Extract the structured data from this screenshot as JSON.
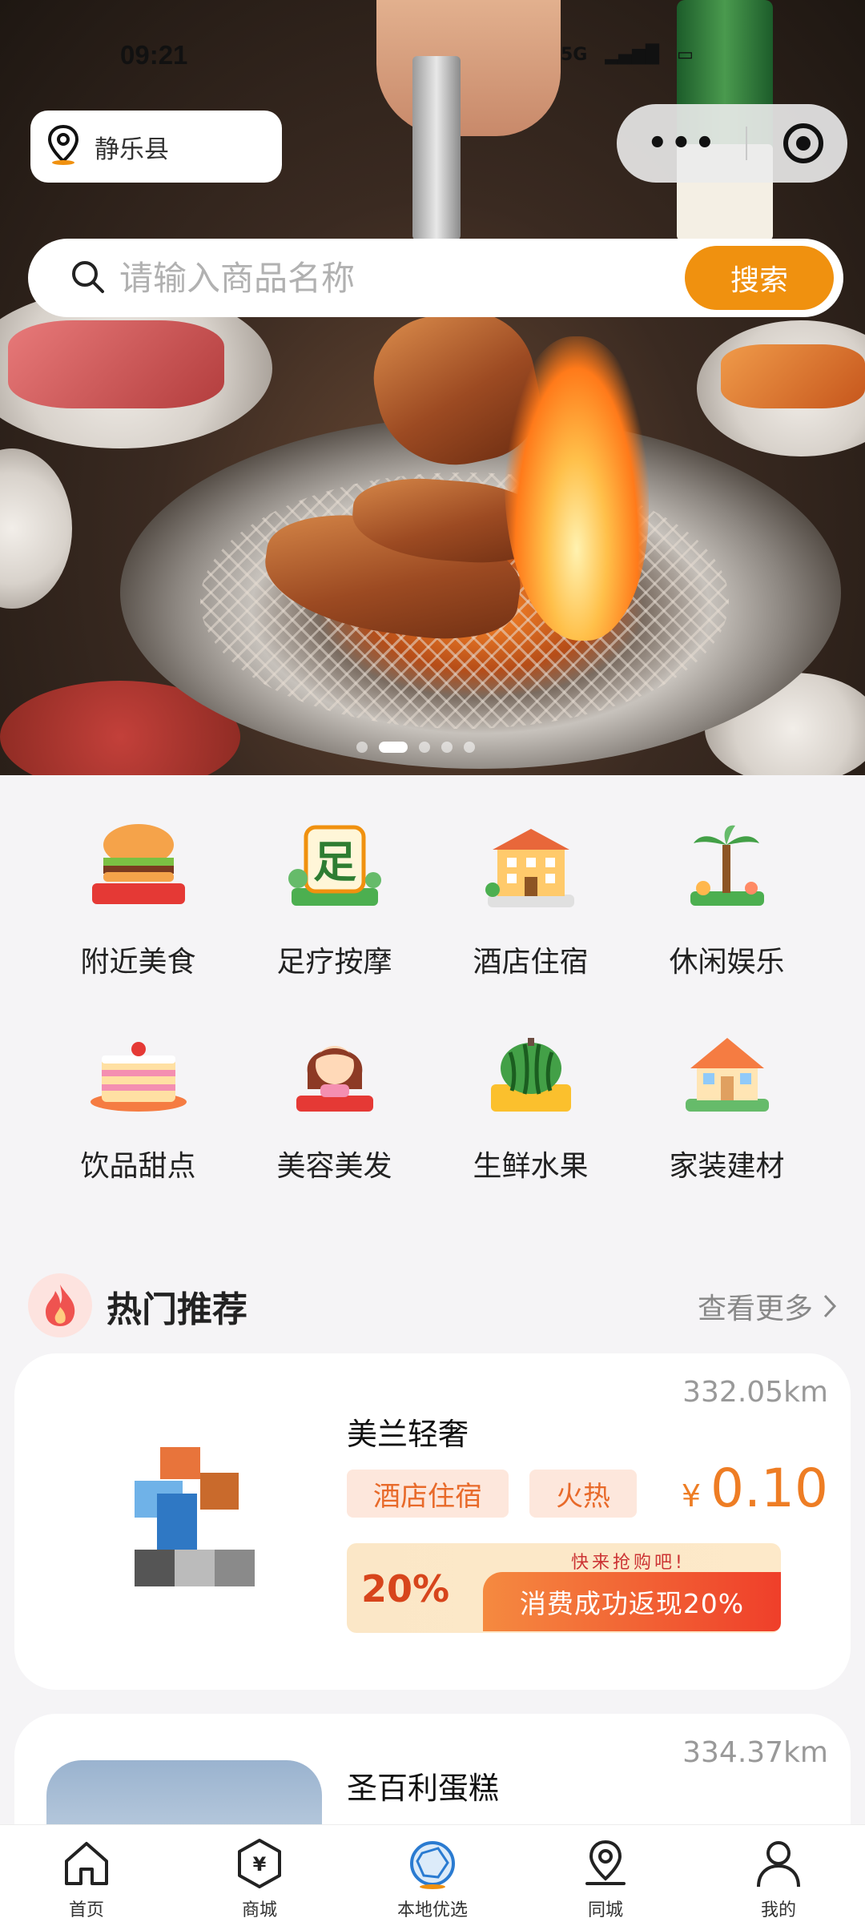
{
  "status_bar": {
    "time": "09:21",
    "network": "5G",
    "signal": "4G",
    "battery": "48"
  },
  "location": {
    "city": "静乐县"
  },
  "capsule": {
    "menu_icon": "more-dots-icon",
    "close_icon": "target-icon"
  },
  "search": {
    "placeholder": "请输入商品名称",
    "value": "",
    "button": "搜索"
  },
  "banner": {
    "slide_count": 5,
    "active_slide": 2
  },
  "categories": [
    {
      "label": "附近美食",
      "icon": "burger-icon"
    },
    {
      "label": "足疗按摩",
      "icon": "foot-icon"
    },
    {
      "label": "酒店住宿",
      "icon": "hotel-icon"
    },
    {
      "label": "休闲娱乐",
      "icon": "palm-island-icon"
    },
    {
      "label": "饮品甜点",
      "icon": "cake-icon"
    },
    {
      "label": "美容美发",
      "icon": "hair-girl-icon"
    },
    {
      "label": "生鲜水果",
      "icon": "watermelon-icon"
    },
    {
      "label": "家装建材",
      "icon": "house-icon"
    }
  ],
  "hot": {
    "title": "热门推荐",
    "more": "查看更多"
  },
  "products": [
    {
      "distance": "332.05km",
      "name": "美兰轻奢",
      "tags": [
        "酒店住宿",
        "火热"
      ],
      "currency": "¥",
      "price": "0.10",
      "promo_percent": "20%",
      "promo_hurry": "快来抢购吧!",
      "promo_text": "消费成功返现20%"
    },
    {
      "distance": "334.37km",
      "name": "圣百利蛋糕"
    }
  ],
  "tabs": [
    {
      "label": "首页",
      "icon": "home-icon",
      "active": false
    },
    {
      "label": "商城",
      "icon": "yen-hexagon-icon",
      "active": false
    },
    {
      "label": "本地优选",
      "icon": "local-lens-icon",
      "active": true
    },
    {
      "label": "同城",
      "icon": "map-pin-icon",
      "active": false
    },
    {
      "label": "我的",
      "icon": "user-icon",
      "active": false
    }
  ],
  "colors": {
    "accent": "#f0910f",
    "price": "#ee7d24",
    "tag_bg": "#fde7dc",
    "tag_text": "#e86a2a"
  }
}
